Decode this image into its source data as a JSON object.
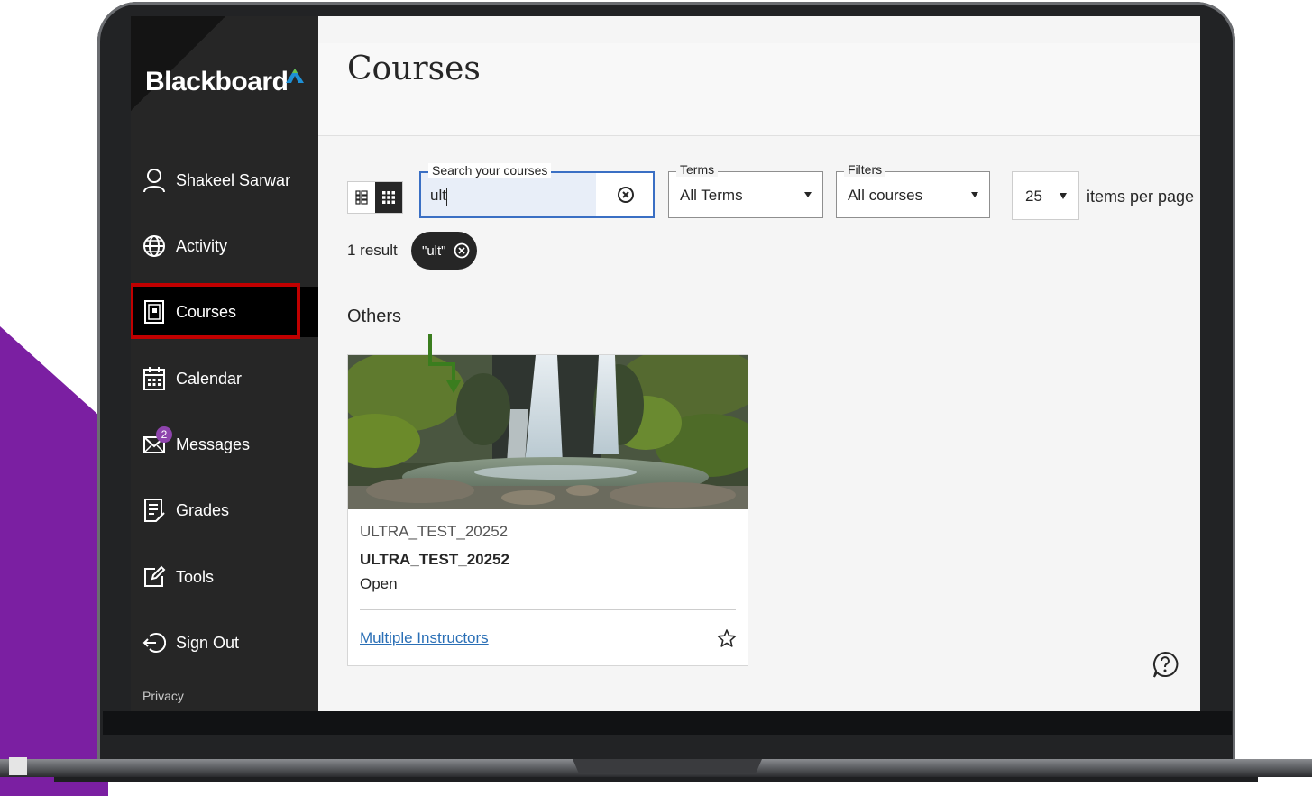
{
  "app": {
    "brand": "Blackboard"
  },
  "user": {
    "name": "Shakeel Sarwar"
  },
  "sidebar": {
    "items": [
      {
        "label": "Shakeel Sarwar",
        "icon": "user-icon"
      },
      {
        "label": "Activity",
        "icon": "globe-icon"
      },
      {
        "label": "Courses",
        "icon": "course-book-icon",
        "active": true
      },
      {
        "label": "Calendar",
        "icon": "calendar-icon"
      },
      {
        "label": "Messages",
        "icon": "envelope-icon",
        "badge": "2"
      },
      {
        "label": "Grades",
        "icon": "grades-icon"
      },
      {
        "label": "Tools",
        "icon": "tools-edit-icon"
      },
      {
        "label": "Sign Out",
        "icon": "sign-out-icon"
      }
    ],
    "privacy": "Privacy"
  },
  "page": {
    "title": "Courses"
  },
  "toolbar": {
    "search": {
      "label": "Search your courses",
      "value": "ult"
    },
    "terms": {
      "label": "Terms",
      "value": "All Terms"
    },
    "filters": {
      "label": "Filters",
      "value": "All courses"
    },
    "per_page": {
      "value": "25",
      "label": "items per page"
    }
  },
  "results": {
    "count_text": "1 result",
    "chip": "\"ult\""
  },
  "section": {
    "heading": "Others"
  },
  "course": {
    "id": "ULTRA_TEST_20252",
    "name": "ULTRA_TEST_20252",
    "status": "Open",
    "instructors": "Multiple Instructors"
  },
  "colors": {
    "sidebar_bg": "#262626",
    "highlight": "#c00000",
    "link": "#2a6fb6",
    "accent_purple": "#7b1fa2",
    "arrow_green": "#3a7d1e"
  }
}
